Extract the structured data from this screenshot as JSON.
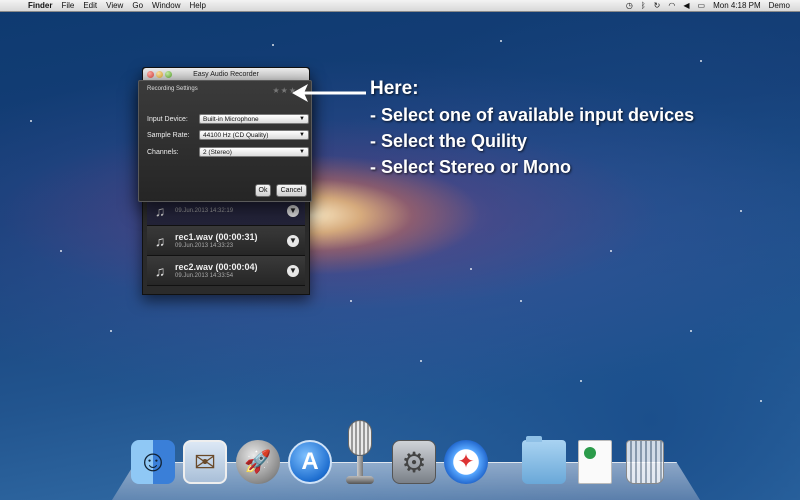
{
  "menubar": {
    "app_name": "Finder",
    "menus": [
      "File",
      "Edit",
      "View",
      "Go",
      "Window",
      "Help"
    ],
    "status": {
      "time": "Mon 4:18 PM",
      "user": "Demo"
    }
  },
  "app_window": {
    "title": "Easy Audio Recorder",
    "recordings": [
      {
        "name": "",
        "date": "09.Jun.2013 14:32:19"
      },
      {
        "name": "rec1.wav (00:00:31)",
        "date": "09.Jun.2013 14:33:23"
      },
      {
        "name": "rec2.wav (00:00:04)",
        "date": "09.Jun.2013 14:33:54"
      }
    ]
  },
  "dialog": {
    "title": "Recording Settings",
    "input_device": {
      "label": "Input Device:",
      "value": "Built-in Microphone"
    },
    "sample_rate": {
      "label": "Sample Rate:",
      "value": "44100 Hz (CD Quality)"
    },
    "channels": {
      "label": "Channels:",
      "value": "2 (Stereo)"
    },
    "ok_label": "Ok",
    "cancel_label": "Cancel"
  },
  "annotation": {
    "heading": "Here:",
    "lines": [
      "- Select one of available input devices",
      "- Select the Quility",
      "- Select Stereo or Mono"
    ]
  },
  "dock": {
    "icons": [
      "finder-icon",
      "mail-icon",
      "launchpad-icon",
      "app-store-icon",
      "microphone-icon",
      "system-preferences-icon",
      "safari-icon",
      "folder-icon",
      "document-icon",
      "trash-icon"
    ]
  }
}
